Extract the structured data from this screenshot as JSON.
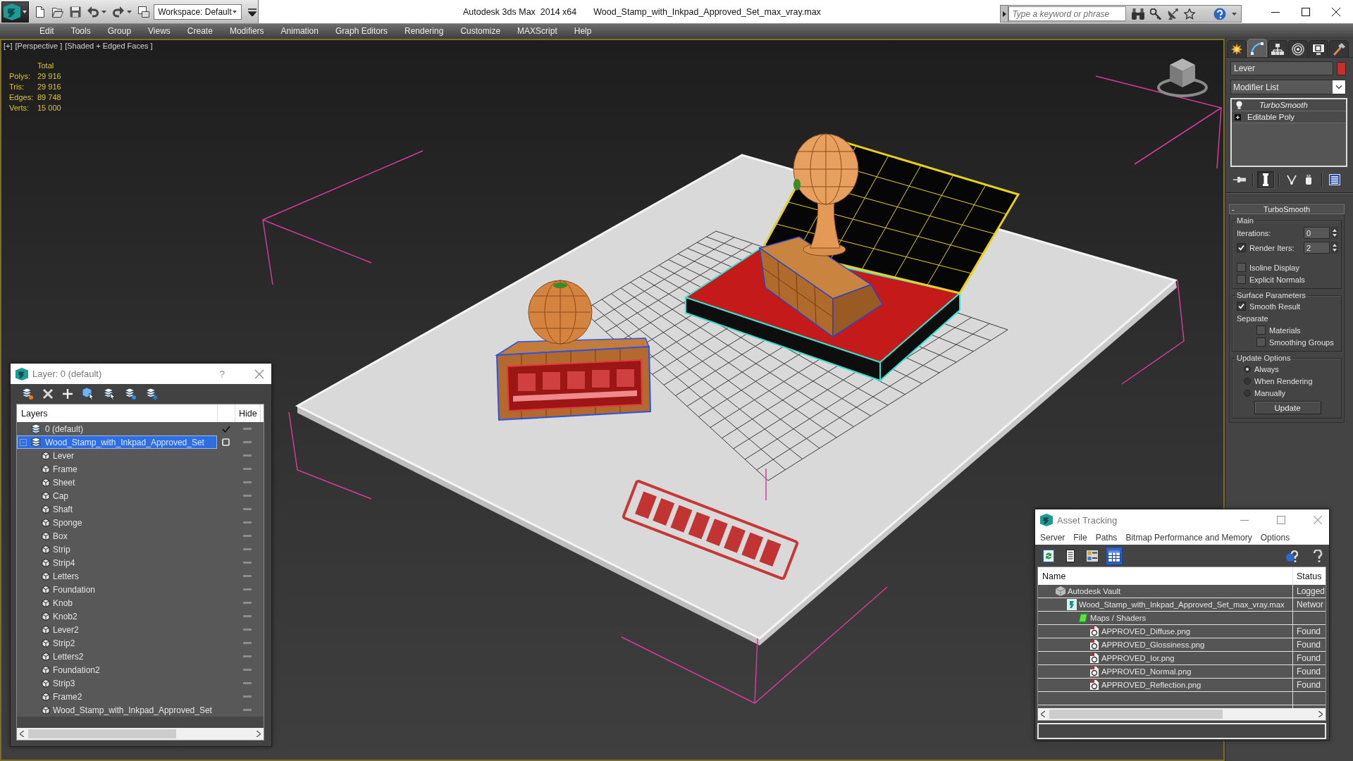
{
  "app": {
    "title": "Autodesk 3ds Max  2014 x64",
    "file": "Wood_Stamp_with_Inkpad_Approved_Set_max_vray.max",
    "workspace": "Workspace: Default",
    "search": {
      "placeholder": "Type a keyword or phrase"
    }
  },
  "menu": [
    "Edit",
    "Tools",
    "Group",
    "Views",
    "Create",
    "Modifiers",
    "Animation",
    "Graph Editors",
    "Rendering",
    "Customize",
    "MAXScript",
    "Help"
  ],
  "viewport": {
    "labels": [
      "[+]",
      "[Perspective ]",
      "[Shaded + Edged Faces ]"
    ],
    "stats": {
      "header": "Total",
      "rows": [
        {
          "label": "Polys:",
          "value": "29 916"
        },
        {
          "label": "Tris:",
          "value": "29 916"
        },
        {
          "label": "Edges:",
          "value": "89 748"
        },
        {
          "label": "Verts:",
          "value": "15 000"
        }
      ]
    }
  },
  "command_panel": {
    "tabs": [
      {
        "kind": "create",
        "selected": false
      },
      {
        "kind": "modify",
        "selected": true
      },
      {
        "kind": "hierarchy",
        "selected": false
      },
      {
        "kind": "motion",
        "selected": false
      },
      {
        "kind": "display",
        "selected": false
      },
      {
        "kind": "utilities",
        "selected": false
      }
    ],
    "object": {
      "name": "Lever",
      "color": "#c82e2e"
    },
    "modifier_list": "Modifier List",
    "stack": [
      {
        "kind": "modifier",
        "name": "TurboSmooth"
      },
      {
        "kind": "base",
        "name": "Editable Poly"
      }
    ],
    "stack_tools": [
      {
        "kind": "pin",
        "selected": false
      },
      {
        "kind": "end-result",
        "selected": true
      },
      {
        "kind": "unique",
        "selected": false
      },
      {
        "kind": "remove",
        "selected": false
      },
      {
        "kind": "configure",
        "selected": false
      }
    ],
    "rollout": {
      "toggle": "-",
      "title": "TurboSmooth",
      "groups": [
        {
          "title": "Main",
          "items": [
            {
              "kind": "spinner",
              "label": "Iterations:",
              "value": "0"
            },
            {
              "kind": "check-spinner",
              "label": "Render Iters:",
              "checked": true,
              "value": "2"
            },
            {
              "kind": "checkbox",
              "label": "Isoline Display",
              "checked": false
            },
            {
              "kind": "checkbox",
              "label": "Explicit Normals",
              "checked": false
            }
          ]
        },
        {
          "title": "Surface Parameters",
          "items": [
            {
              "kind": "checkbox",
              "label": "Smooth Result",
              "checked": true
            },
            {
              "kind": "label",
              "label": "Separate"
            },
            {
              "kind": "sub-checkbox",
              "label": "Materials",
              "checked": false
            },
            {
              "kind": "sub-checkbox",
              "label": "Smoothing Groups",
              "checked": false
            }
          ]
        },
        {
          "title": "Update Options",
          "items": [
            {
              "kind": "radio",
              "label": "Always",
              "selected": true
            },
            {
              "kind": "radio",
              "label": "When Rendering",
              "selected": false
            },
            {
              "kind": "radio",
              "label": "Manually",
              "selected": false
            },
            {
              "kind": "button",
              "label": "Update"
            }
          ]
        }
      ]
    }
  },
  "layer_window": {
    "title": "Layer: 0 (default)",
    "help": "?",
    "columns": {
      "name": "Layers",
      "hide": "Hide"
    },
    "layers": [
      {
        "name": "0 (default)",
        "current": true,
        "selected": false
      },
      {
        "name": "Wood_Stamp_with_Inkpad_Approved_Set",
        "current": false,
        "selected": true,
        "expanded": true,
        "children": [
          {
            "name": "Lever",
            "selected": false
          },
          {
            "name": "Frame",
            "selected": false
          },
          {
            "name": "Sheet",
            "selected": false
          },
          {
            "name": "Cap",
            "selected": false
          },
          {
            "name": "Shaft",
            "selected": false
          },
          {
            "name": "Sponge",
            "selected": false
          },
          {
            "name": "Box",
            "selected": false
          },
          {
            "name": "Strip",
            "selected": false
          },
          {
            "name": "Strip4",
            "selected": false
          },
          {
            "name": "Letters",
            "selected": false
          },
          {
            "name": "Foundation",
            "selected": false
          },
          {
            "name": "Knob",
            "selected": false
          },
          {
            "name": "Knob2",
            "selected": false
          },
          {
            "name": "Lever2",
            "selected": false
          },
          {
            "name": "Strip2",
            "selected": false
          },
          {
            "name": "Letters2",
            "selected": false
          },
          {
            "name": "Foundation2",
            "selected": false
          },
          {
            "name": "Strip3",
            "selected": false
          },
          {
            "name": "Frame2",
            "selected": false
          },
          {
            "name": "Wood_Stamp_with_Inkpad_Approved_Set",
            "selected": false
          }
        ]
      }
    ]
  },
  "asset_window": {
    "title": "Asset Tracking",
    "menu": [
      "Server",
      "File",
      "Paths",
      "Bitmap Performance and Memory",
      "Options"
    ],
    "toolbar": [
      {
        "kind": "refresh",
        "selected": false
      },
      {
        "kind": "list",
        "selected": false
      },
      {
        "kind": "thumbnails",
        "selected": false
      },
      {
        "kind": "table",
        "selected": true
      }
    ],
    "columns": {
      "name": "Name",
      "status": "Status"
    },
    "rows": [
      {
        "kind": "vault",
        "name": "Autodesk Vault",
        "status": "Logged",
        "children": [
          {
            "kind": "scene",
            "name": "Wood_Stamp_with_Inkpad_Approved_Set_max_vray.max",
            "status": "Networ",
            "children": [
              {
                "kind": "folder",
                "name": "Maps / Shaders",
                "children": [
                  {
                    "kind": "bitmap",
                    "name": "APPROVED_Diffuse.png",
                    "status": "Found"
                  },
                  {
                    "kind": "bitmap",
                    "name": "APPROVED_Glossiness.png",
                    "status": "Found"
                  },
                  {
                    "kind": "bitmap",
                    "name": "APPROVED_Ior.png",
                    "status": "Found"
                  },
                  {
                    "kind": "bitmap",
                    "name": "APPROVED_Normal.png",
                    "status": "Found"
                  },
                  {
                    "kind": "bitmap",
                    "name": "APPROVED_Reflection.png",
                    "status": "Found"
                  }
                ]
              }
            ]
          }
        ]
      }
    ]
  }
}
